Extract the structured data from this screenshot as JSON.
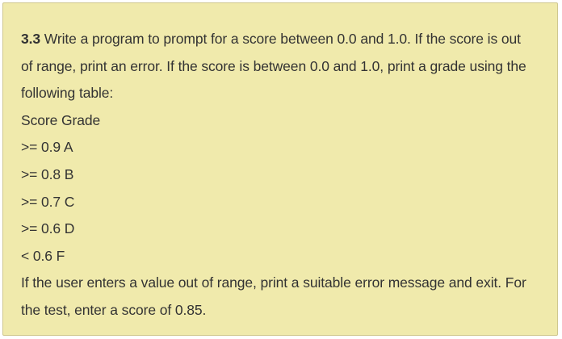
{
  "exercise": {
    "number": "3.3",
    "intro_lines": [
      "Write a program to prompt for a score between 0.0 and 1.0. If the score is out",
      "of range, print an error. If the score is between 0.0 and 1.0, print a grade using the",
      "following table:"
    ],
    "table_header": "Score Grade",
    "table_rows": [
      ">= 0.9 A",
      ">= 0.8 B",
      ">= 0.7 C",
      ">= 0.6 D",
      "< 0.6 F"
    ],
    "closing_lines": [
      "If the user enters a value out of range, print a suitable error message and exit. For",
      "the test, enter a score of 0.85."
    ]
  },
  "colors": {
    "panel_background": "#f0eaac",
    "panel_border": "#cfc78f",
    "text": "#333333"
  }
}
